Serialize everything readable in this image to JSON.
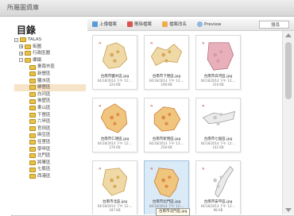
{
  "window": {
    "title": "所屬圖資庫"
  },
  "sidebar": {
    "heading": "目錄",
    "tree": [
      {
        "label": "TALAS",
        "depth": 0,
        "toggle": "-"
      },
      {
        "label": "街圖",
        "depth": 1,
        "toggle": "+"
      },
      {
        "label": "行政區圖",
        "depth": 1,
        "toggle": "+"
      },
      {
        "label": "鄉鎮",
        "depth": 1,
        "toggle": "-"
      },
      {
        "label": "臺南市區",
        "depth": 2
      },
      {
        "label": "新營區",
        "depth": 2
      },
      {
        "label": "鹽水區",
        "depth": 2
      },
      {
        "label": "柳營區",
        "depth": 2,
        "selected": true
      },
      {
        "label": "白河區",
        "depth": 2
      },
      {
        "label": "後壁區",
        "depth": 2
      },
      {
        "label": "東山區",
        "depth": 2
      },
      {
        "label": "下營區",
        "depth": 2
      },
      {
        "label": "六甲區",
        "depth": 2
      },
      {
        "label": "官田區",
        "depth": 2
      },
      {
        "label": "麻豆區",
        "depth": 2
      },
      {
        "label": "佳里區",
        "depth": 2
      },
      {
        "label": "學甲區",
        "depth": 2
      },
      {
        "label": "北門區",
        "depth": 2
      },
      {
        "label": "將軍區",
        "depth": 2
      },
      {
        "label": "七股區",
        "depth": 2
      },
      {
        "label": "西港區",
        "depth": 2
      }
    ]
  },
  "toolbar": {
    "upload": "上傳檔案",
    "delete": "刪除檔案",
    "rename": "檔案改名",
    "preview": "Preview",
    "search": "搜尋"
  },
  "colors": {
    "selected_bg": "#dbeaf7",
    "tree_selected": "#f6e4c8",
    "folder": "#e7c24a"
  },
  "files": [
    {
      "name": "台南市鹽水區.jpg",
      "date": "04/18/2014 下午 12:...",
      "size": "224 KB",
      "style": "tan",
      "selected": false
    },
    {
      "name": "台南市下營區.jpg",
      "date": "04/18/2014 下午 12:...",
      "size": "198 KB",
      "style": "tan",
      "selected": false
    },
    {
      "name": "台南市白河區.jpg",
      "date": "04/18/2014 下午 12:...",
      "size": "310 KB",
      "style": "pink",
      "selected": false
    },
    {
      "name": "台南市仁德區.jpg",
      "date": "04/18/2014 下午 12:...",
      "size": "276 KB",
      "style": "orange",
      "selected": false
    },
    {
      "name": "台南市新營區.jpg",
      "date": "04/18/2014 下午 12:...",
      "size": "258 KB",
      "style": "orange",
      "selected": false
    },
    {
      "name": "台南市七股區.jpg",
      "date": "04/18/2014 下午 12:...",
      "size": "142 KB",
      "style": "grey",
      "selected": false
    },
    {
      "name": "台南市北區.jpg",
      "date": "04/18/2014 下午 12:...",
      "size": "187 KB",
      "style": "tan",
      "selected": false
    },
    {
      "name": "台南市北門區.jpg",
      "date": "04/18/2014 下午 12:...",
      "size": "236 KB",
      "style": "orange",
      "selected": true
    },
    {
      "name": "台南市安平區.jpg",
      "date": "04/18/2014 下午 12:...",
      "size": "98 KB",
      "style": "grey",
      "selected": false
    }
  ],
  "tooltip": "台南市北門區.jpg"
}
